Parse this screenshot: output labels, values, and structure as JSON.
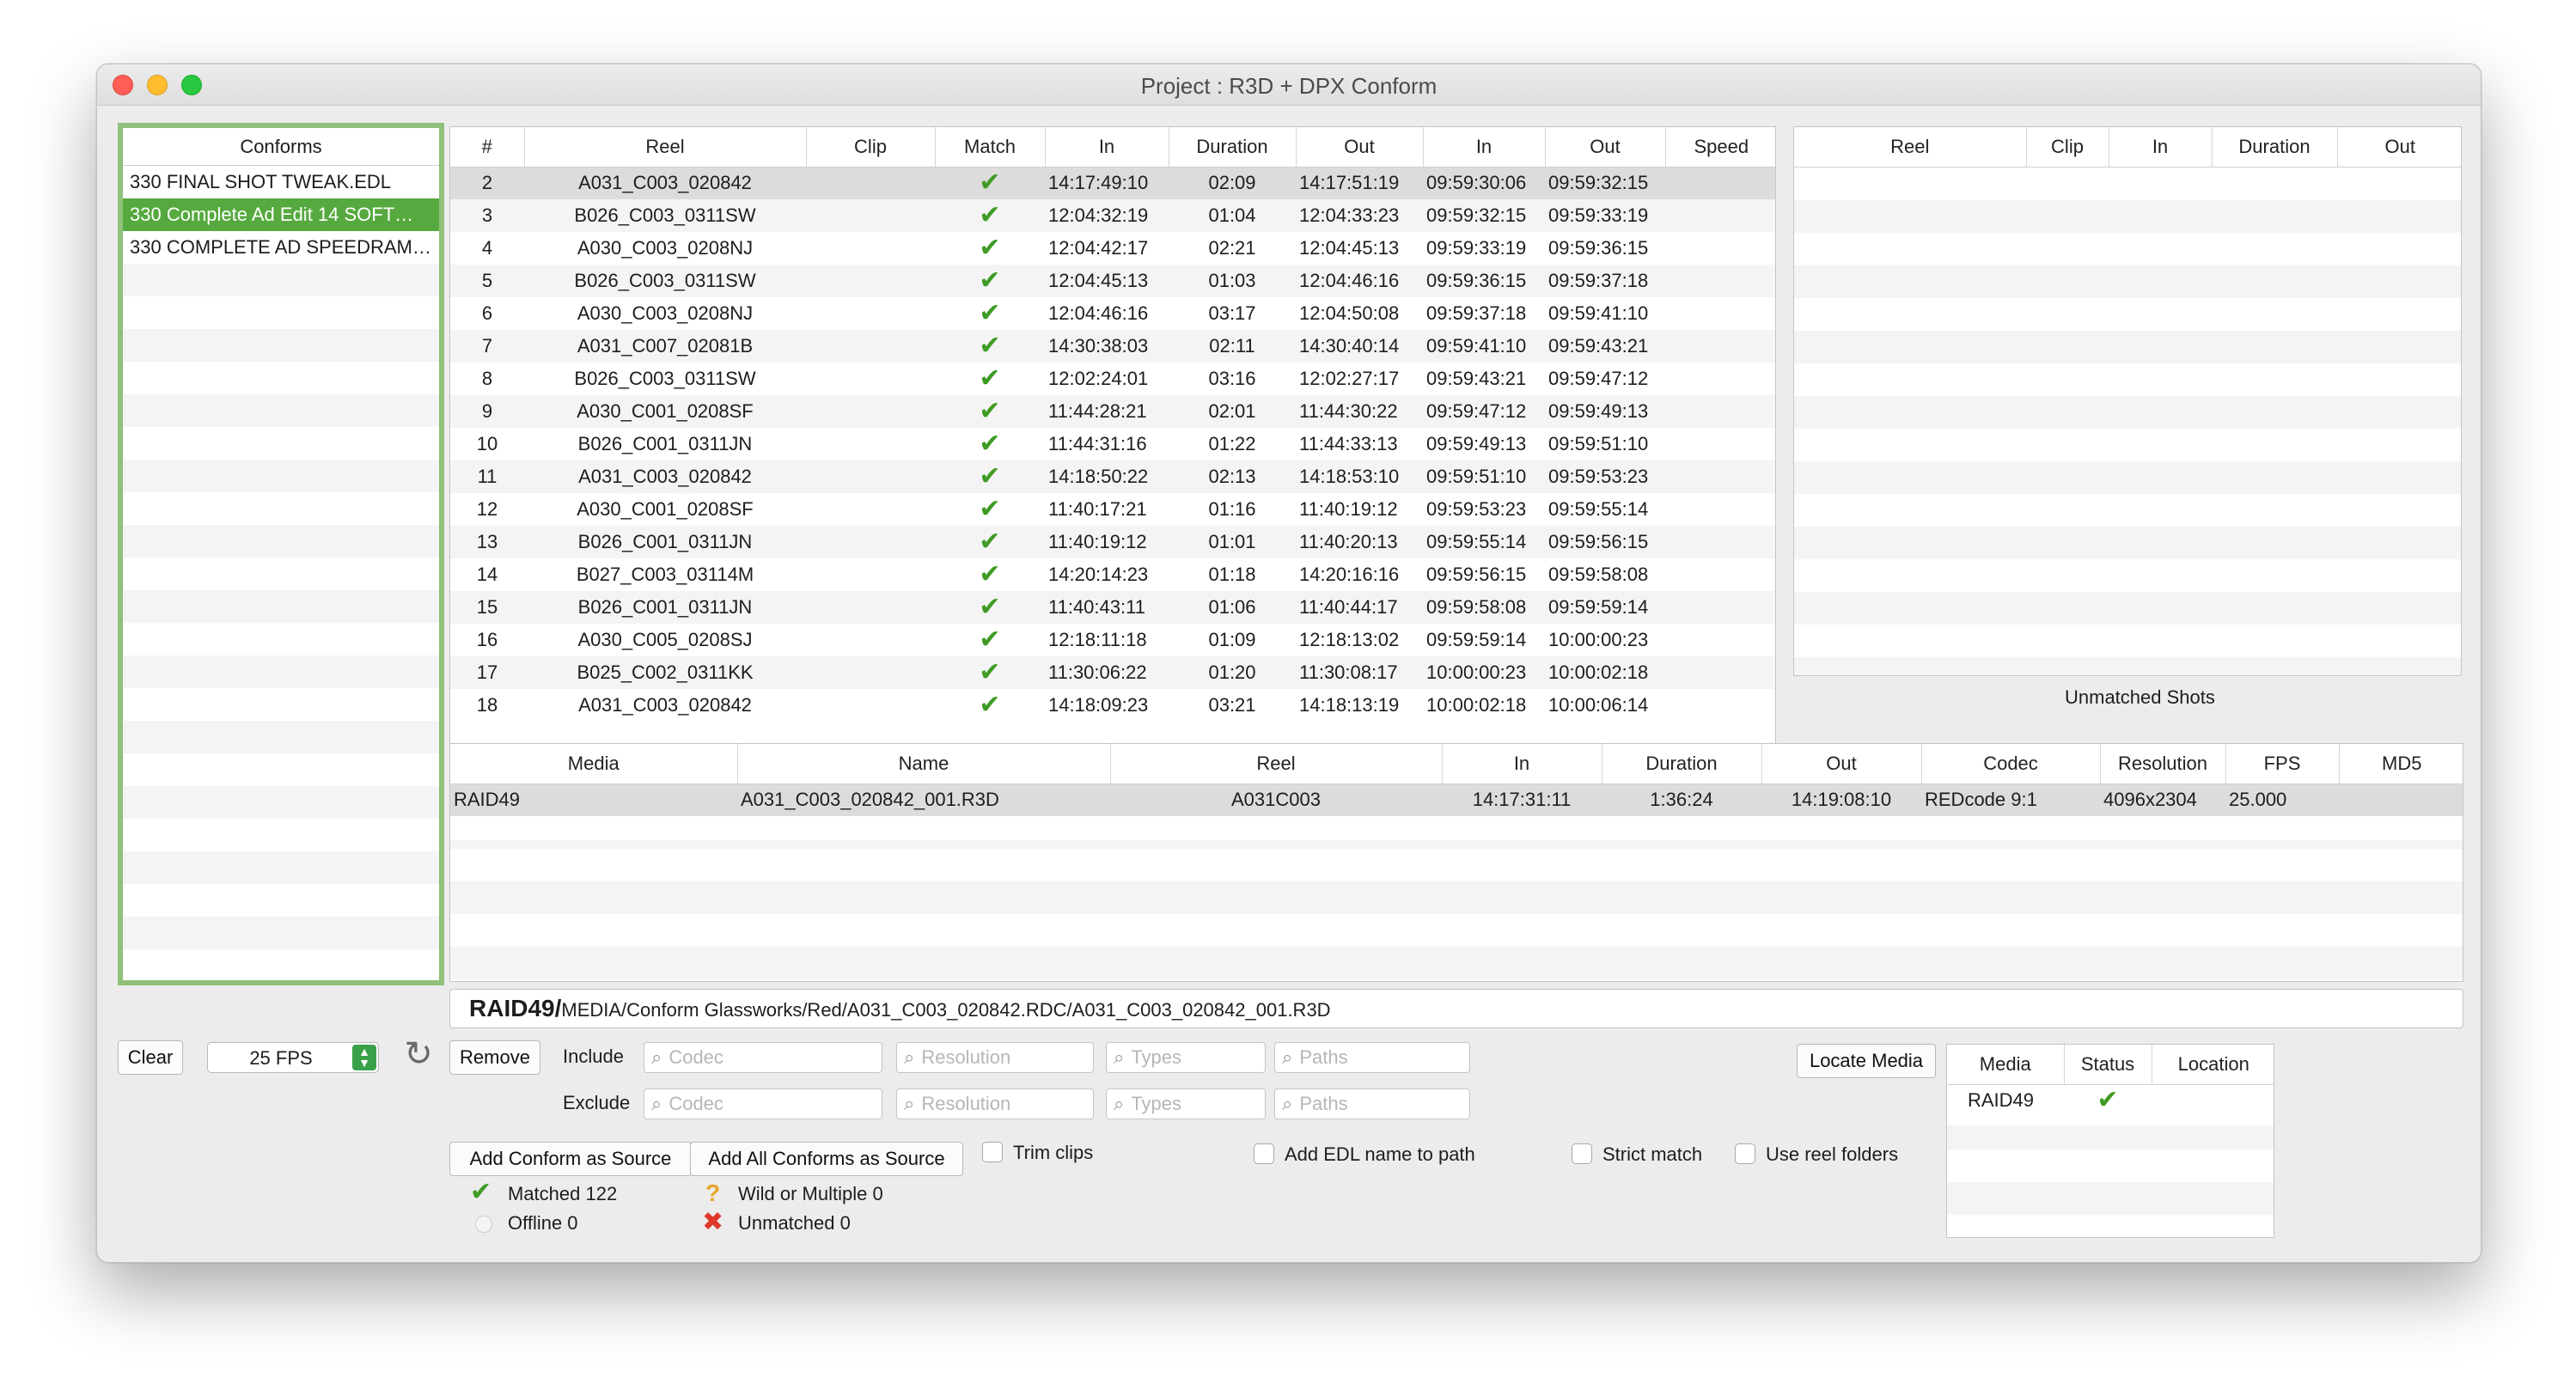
{
  "window": {
    "title": "Project : R3D + DPX Conform"
  },
  "conforms": {
    "header": "Conforms",
    "items": [
      "330  FINAL SHOT TWEAK.EDL",
      "330 Complete Ad Edit 14 SOFT…",
      "330 COMPLETE AD SPEEDRAM…"
    ],
    "selected_index": 1
  },
  "events": {
    "columns": [
      "#",
      "Reel",
      "Clip",
      "Match",
      "In",
      "Duration",
      "Out",
      "In",
      "Out",
      "Speed"
    ],
    "rows": [
      [
        "2",
        "A031_C003_020842",
        "",
        "check",
        "14:17:49:10",
        "02:09",
        "14:17:51:19",
        "09:59:30:06",
        "09:59:32:15",
        ""
      ],
      [
        "3",
        "B026_C003_0311SW",
        "",
        "check",
        "12:04:32:19",
        "01:04",
        "12:04:33:23",
        "09:59:32:15",
        "09:59:33:19",
        ""
      ],
      [
        "4",
        "A030_C003_0208NJ",
        "",
        "check",
        "12:04:42:17",
        "02:21",
        "12:04:45:13",
        "09:59:33:19",
        "09:59:36:15",
        ""
      ],
      [
        "5",
        "B026_C003_0311SW",
        "",
        "check",
        "12:04:45:13",
        "01:03",
        "12:04:46:16",
        "09:59:36:15",
        "09:59:37:18",
        ""
      ],
      [
        "6",
        "A030_C003_0208NJ",
        "",
        "check",
        "12:04:46:16",
        "03:17",
        "12:04:50:08",
        "09:59:37:18",
        "09:59:41:10",
        ""
      ],
      [
        "7",
        "A031_C007_02081B",
        "",
        "check",
        "14:30:38:03",
        "02:11",
        "14:30:40:14",
        "09:59:41:10",
        "09:59:43:21",
        ""
      ],
      [
        "8",
        "B026_C003_0311SW",
        "",
        "check",
        "12:02:24:01",
        "03:16",
        "12:02:27:17",
        "09:59:43:21",
        "09:59:47:12",
        ""
      ],
      [
        "9",
        "A030_C001_0208SF",
        "",
        "check",
        "11:44:28:21",
        "02:01",
        "11:44:30:22",
        "09:59:47:12",
        "09:59:49:13",
        ""
      ],
      [
        "10",
        "B026_C001_0311JN",
        "",
        "check",
        "11:44:31:16",
        "01:22",
        "11:44:33:13",
        "09:59:49:13",
        "09:59:51:10",
        ""
      ],
      [
        "11",
        "A031_C003_020842",
        "",
        "check",
        "14:18:50:22",
        "02:13",
        "14:18:53:10",
        "09:59:51:10",
        "09:59:53:23",
        ""
      ],
      [
        "12",
        "A030_C001_0208SF",
        "",
        "check",
        "11:40:17:21",
        "01:16",
        "11:40:19:12",
        "09:59:53:23",
        "09:59:55:14",
        ""
      ],
      [
        "13",
        "B026_C001_0311JN",
        "",
        "check",
        "11:40:19:12",
        "01:01",
        "11:40:20:13",
        "09:59:55:14",
        "09:59:56:15",
        ""
      ],
      [
        "14",
        "B027_C003_03114M",
        "",
        "check",
        "14:20:14:23",
        "01:18",
        "14:20:16:16",
        "09:59:56:15",
        "09:59:58:08",
        ""
      ],
      [
        "15",
        "B026_C001_0311JN",
        "",
        "check",
        "11:40:43:11",
        "01:06",
        "11:40:44:17",
        "09:59:58:08",
        "09:59:59:14",
        ""
      ],
      [
        "16",
        "A030_C005_0208SJ",
        "",
        "check",
        "12:18:11:18",
        "01:09",
        "12:18:13:02",
        "09:59:59:14",
        "10:00:00:23",
        ""
      ],
      [
        "17",
        "B025_C002_0311KK",
        "",
        "check",
        "11:30:06:22",
        "01:20",
        "11:30:08:17",
        "10:00:00:23",
        "10:00:02:18",
        ""
      ],
      [
        "18",
        "A031_C003_020842",
        "",
        "check",
        "14:18:09:23",
        "03:21",
        "14:18:13:19",
        "10:00:02:18",
        "10:00:06:14",
        ""
      ]
    ]
  },
  "unmatched": {
    "columns": [
      "Reel",
      "Clip",
      "In",
      "Duration",
      "Out"
    ],
    "caption": "Unmatched Shots"
  },
  "media": {
    "columns": [
      "Media",
      "Name",
      "Reel",
      "In",
      "Duration",
      "Out",
      "Codec",
      "Resolution",
      "FPS",
      "MD5"
    ],
    "rows": [
      [
        "RAID49",
        "A031_C003_020842_001.R3D",
        "A031C003",
        "14:17:31:11",
        "1:36:24",
        "14:19:08:10",
        "REDcode 9:1",
        "4096x2304",
        "25.000",
        ""
      ]
    ]
  },
  "path": {
    "root": "RAID49/",
    "rest": "MEDIA/Conform Glassworks/Red/A031_C003_020842.RDC/A031_C003_020842_001.R3D"
  },
  "controls": {
    "clear": "Clear",
    "fps": "25 FPS",
    "remove": "Remove",
    "include": "Include",
    "exclude": "Exclude",
    "ph_codec": "Codec",
    "ph_resolution": "Resolution",
    "ph_types": "Types",
    "ph_paths": "Paths",
    "add_conform": "Add Conform as Source",
    "add_all": "Add All Conforms as Source",
    "trim": "Trim clips",
    "add_edl": "Add EDL name to path",
    "strict": "Strict match",
    "reel_folders": "Use reel folders",
    "locate": "Locate Media"
  },
  "stats": {
    "matched": "Matched 122",
    "offline": "Offline 0",
    "wild": "Wild or Multiple 0",
    "unmatched": "Unmatched 0"
  },
  "locations": {
    "columns": [
      "Media",
      "Status",
      "Location"
    ],
    "rows": [
      [
        "RAID49",
        "check",
        ""
      ]
    ]
  }
}
